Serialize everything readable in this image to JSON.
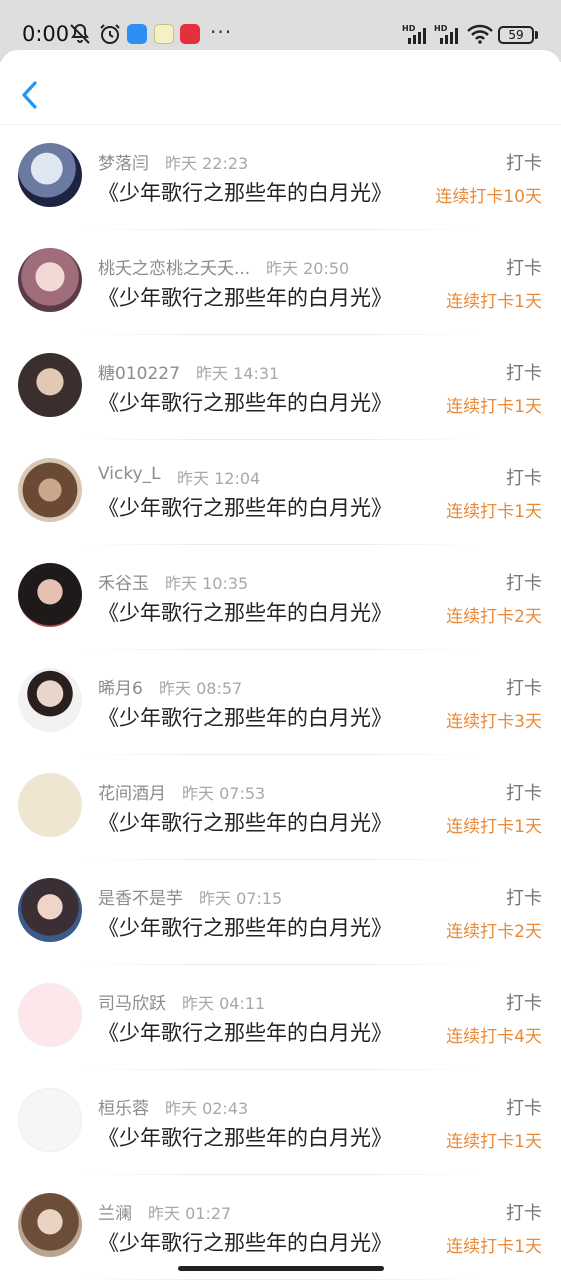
{
  "status_bar": {
    "time": "0:00",
    "battery": "59"
  },
  "header": {
    "back_icon": "chevron-left-icon"
  },
  "items": [
    {
      "name": "梦落闫",
      "time": "昨天 22:23",
      "title": "《少年歌行之那些年的白月光》",
      "label": "打卡",
      "streak": "连续打卡10天"
    },
    {
      "name": "桃夭之恋桃之夭夭...",
      "time": "昨天 20:50",
      "title": "《少年歌行之那些年的白月光》",
      "label": "打卡",
      "streak": "连续打卡1天"
    },
    {
      "name": "糖010227",
      "time": "昨天 14:31",
      "title": "《少年歌行之那些年的白月光》",
      "label": "打卡",
      "streak": "连续打卡1天"
    },
    {
      "name": "Vicky_L",
      "time": "昨天 12:04",
      "title": "《少年歌行之那些年的白月光》",
      "label": "打卡",
      "streak": "连续打卡1天"
    },
    {
      "name": "禾谷玉",
      "time": "昨天 10:35",
      "title": "《少年歌行之那些年的白月光》",
      "label": "打卡",
      "streak": "连续打卡2天"
    },
    {
      "name": "晞月6",
      "time": "昨天 08:57",
      "title": "《少年歌行之那些年的白月光》",
      "label": "打卡",
      "streak": "连续打卡3天"
    },
    {
      "name": "花间酒月",
      "time": "昨天 07:53",
      "title": "《少年歌行之那些年的白月光》",
      "label": "打卡",
      "streak": "连续打卡1天"
    },
    {
      "name": "是香不是芋",
      "time": "昨天 07:15",
      "title": "《少年歌行之那些年的白月光》",
      "label": "打卡",
      "streak": "连续打卡2天"
    },
    {
      "name": "司马欣跃",
      "time": "昨天 04:11",
      "title": "《少年歌行之那些年的白月光》",
      "label": "打卡",
      "streak": "连续打卡4天"
    },
    {
      "name": "桓乐蓉",
      "time": "昨天 02:43",
      "title": "《少年歌行之那些年的白月光》",
      "label": "打卡",
      "streak": "连续打卡1天"
    },
    {
      "name": "兰澜",
      "time": "昨天 01:27",
      "title": "《少年歌行之那些年的白月光》",
      "label": "打卡",
      "streak": "连续打卡1天"
    }
  ],
  "colors": {
    "accent": "#2196f3",
    "streak": "#e88a3a",
    "status_bar_bg": "#dedede"
  }
}
